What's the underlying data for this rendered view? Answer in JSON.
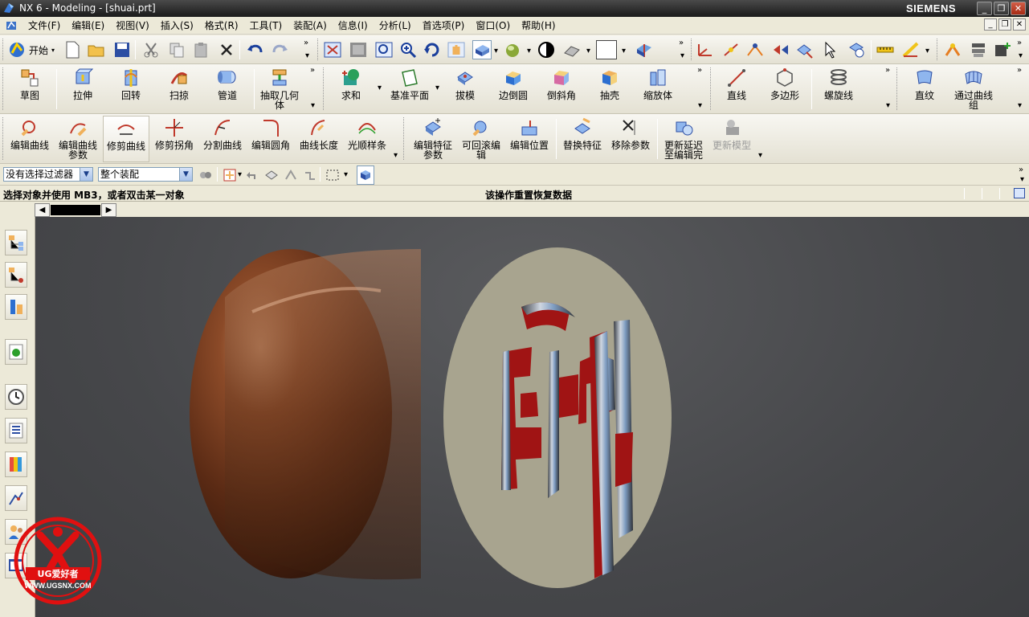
{
  "window": {
    "title": "NX 6 - Modeling - [shuai.prt]",
    "brand": "SIEMENS"
  },
  "menu": [
    "文件(F)",
    "编辑(E)",
    "视图(V)",
    "插入(S)",
    "格式(R)",
    "工具(T)",
    "装配(A)",
    "信息(I)",
    "分析(L)",
    "首选项(P)",
    "窗口(O)",
    "帮助(H)"
  ],
  "toolbar1": {
    "start_label": "开始"
  },
  "toolbar2": [
    {
      "id": "sketch",
      "label": "草图"
    },
    {
      "id": "extrude",
      "label": "拉伸"
    },
    {
      "id": "revolve",
      "label": "回转"
    },
    {
      "id": "sweep",
      "label": "扫掠"
    },
    {
      "id": "tube",
      "label": "管道"
    },
    {
      "id": "extract",
      "label": "抽取几何\n体"
    },
    {
      "id": "unite",
      "label": "求和"
    },
    {
      "id": "datum-plane",
      "label": "基准平面"
    },
    {
      "id": "draft",
      "label": "拔模"
    },
    {
      "id": "edge-blend",
      "label": "边倒圆"
    },
    {
      "id": "chamfer",
      "label": "倒斜角"
    },
    {
      "id": "shell",
      "label": "抽壳"
    },
    {
      "id": "scale",
      "label": "缩放体"
    },
    {
      "id": "line",
      "label": "直线"
    },
    {
      "id": "polygon",
      "label": "多边形"
    },
    {
      "id": "helix",
      "label": "螺旋线"
    },
    {
      "id": "ruled",
      "label": "直纹"
    },
    {
      "id": "through-curves",
      "label": "通过曲线\n组"
    }
  ],
  "toolbar3": [
    {
      "id": "edit-curve",
      "label": "编辑曲线"
    },
    {
      "id": "edit-curve-params",
      "label": "编辑曲线\n参数"
    },
    {
      "id": "trim-curve",
      "label": "修剪曲线"
    },
    {
      "id": "trim-corner",
      "label": "修剪拐角"
    },
    {
      "id": "divide-curve",
      "label": "分割曲线"
    },
    {
      "id": "edit-fillet",
      "label": "编辑圆角"
    },
    {
      "id": "curve-length",
      "label": "曲线长度"
    },
    {
      "id": "smooth-spline",
      "label": "光顺样条"
    },
    {
      "id": "edit-feature-params",
      "label": "编辑特征\n参数"
    },
    {
      "id": "rollback-edit",
      "label": "可回滚编\n辑"
    },
    {
      "id": "edit-position",
      "label": "编辑位置"
    },
    {
      "id": "replace-feature",
      "label": "替换特征"
    },
    {
      "id": "remove-params",
      "label": "移除参数"
    },
    {
      "id": "update-delayed",
      "label": "更新延迟\n至编辑完"
    },
    {
      "id": "update-model",
      "label": "更新模型"
    }
  ],
  "filter": {
    "type_filter": "没有选择过滤器",
    "scope": "整个装配"
  },
  "status": {
    "prompt": "选择对象并使用 MB3，或者双击某一对象",
    "message": "该操作重置恢复数据"
  },
  "watermark": {
    "text": "UG爱好者",
    "url": "WWW.UGSNX.COM"
  },
  "colors": {
    "part_face": "#a8a48f",
    "part_body": "#6b3a20",
    "cut_red": "#a01414",
    "viewport_bg": "#46474a"
  }
}
